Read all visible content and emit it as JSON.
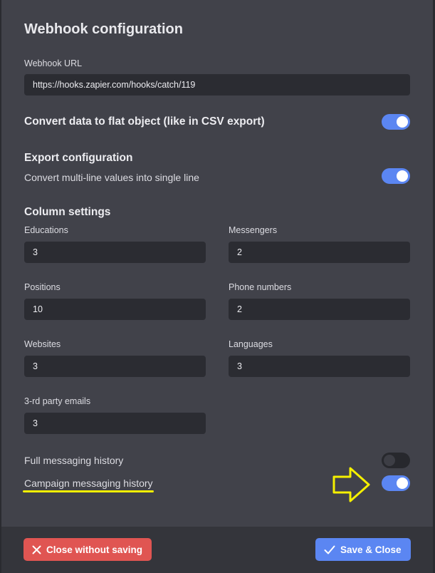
{
  "dialog": {
    "title": "Webhook configuration",
    "webhook_url_label": "Webhook URL",
    "webhook_url_value": "https://hooks.zapier.com/hooks/catch/119",
    "flat_object_label": "Convert data to flat object (like in CSV export)",
    "flat_object_on": true,
    "export_config_heading": "Export configuration",
    "multiline_label": "Convert multi-line values into single line",
    "multiline_on": true,
    "column_settings_heading": "Column settings",
    "columns": {
      "educations": {
        "label": "Educations",
        "value": "3"
      },
      "messengers": {
        "label": "Messengers",
        "value": "2"
      },
      "positions": {
        "label": "Positions",
        "value": "10"
      },
      "phone_numbers": {
        "label": "Phone numbers",
        "value": "2"
      },
      "websites": {
        "label": "Websites",
        "value": "3"
      },
      "languages": {
        "label": "Languages",
        "value": "3"
      },
      "third_party_emails": {
        "label": "3-rd party emails",
        "value": "3"
      }
    },
    "full_history_label": "Full messaging history",
    "full_history_on": false,
    "campaign_history_label": "Campaign messaging history",
    "campaign_history_on": true
  },
  "footer": {
    "close_label": "Close without saving",
    "save_label": "Save & Close"
  },
  "colors": {
    "accent": "#5b86f2",
    "danger": "#e05552",
    "annotation": "#f5f000"
  },
  "icons": {
    "close": "close-icon",
    "check": "check-icon",
    "arrow": "arrow-right-icon"
  }
}
